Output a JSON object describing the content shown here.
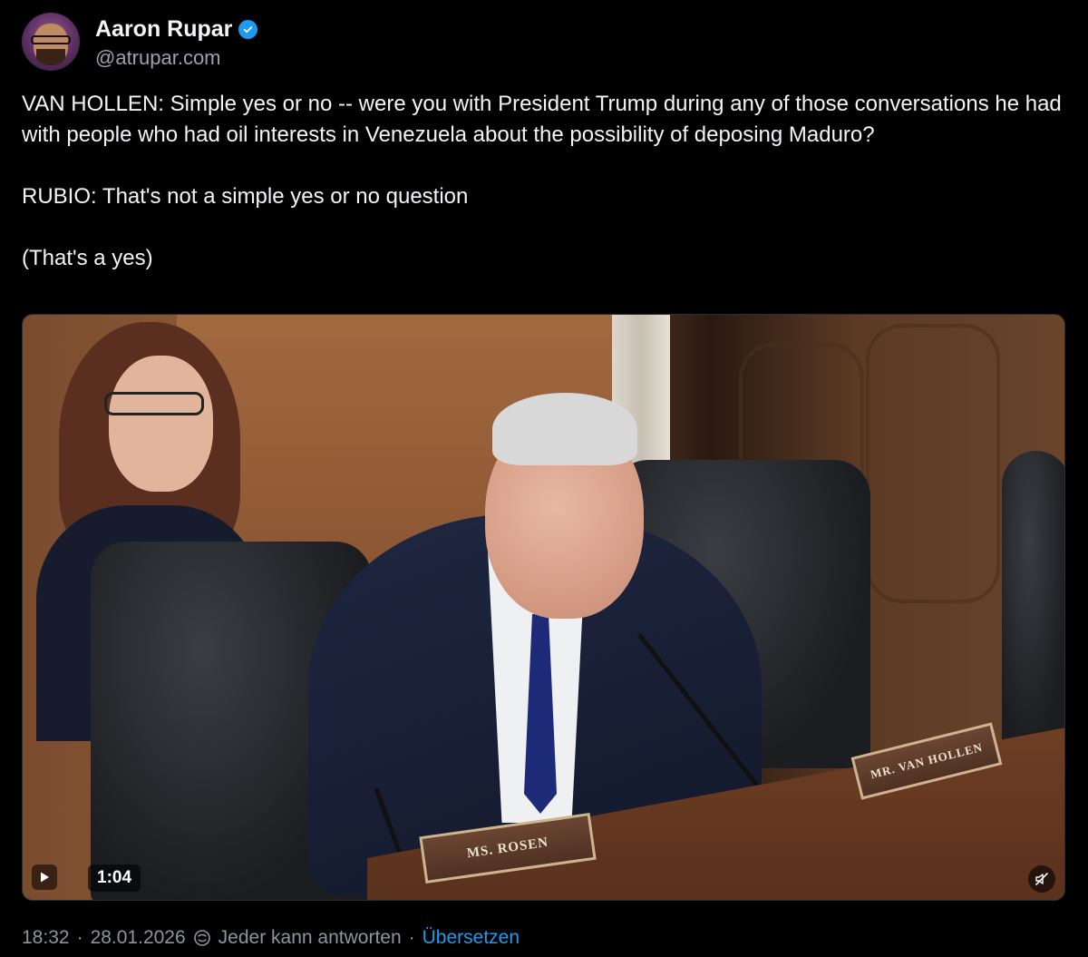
{
  "author": {
    "display_name": "Aaron Rupar",
    "handle": "@atrupar.com",
    "verified": true,
    "avatar_icon": "avatar-icon"
  },
  "post": {
    "text": "VAN HOLLEN: Simple yes or no -- were you with President Trump during any of those conversations he had with people who had oil interests in Venezuela about the possibility of deposing Maduro?\n\nRUBIO: That's not a simple yes or no question\n\n(That's a yes)"
  },
  "media": {
    "type": "video",
    "duration": "1:04",
    "nameplates": {
      "left": "MS. ROSEN",
      "right": "MR. VAN HOLLEN"
    },
    "muted": true,
    "icons": {
      "play": "play-icon",
      "mute": "speaker-muted-icon"
    }
  },
  "footer": {
    "time": "18:32",
    "date": "28.01.2026",
    "reply_setting": "Jeder kann antworten",
    "translate_label": "Übersetzen",
    "separator": "·"
  },
  "colors": {
    "accent": "#1d9bf0",
    "text": "#f2f4f6",
    "muted": "#8b96a1",
    "background": "#000000"
  }
}
